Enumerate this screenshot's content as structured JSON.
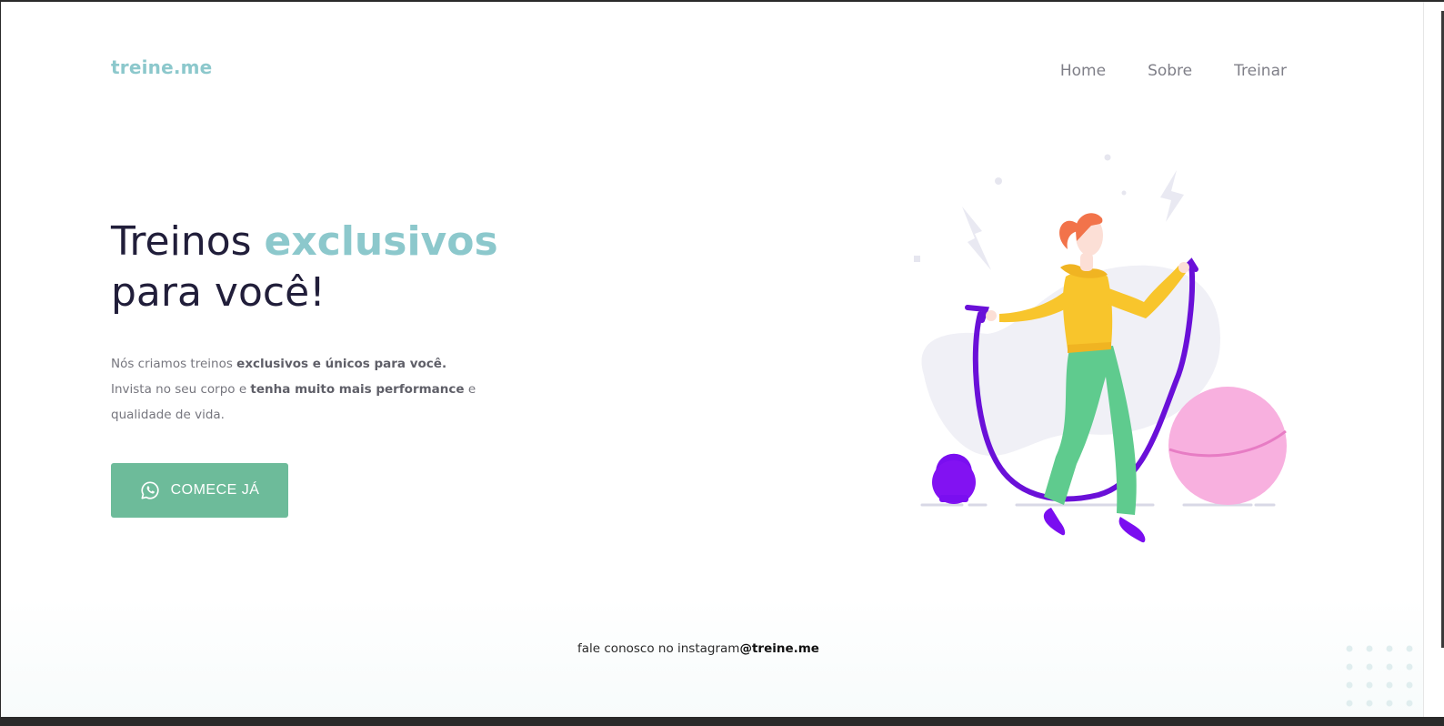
{
  "header": {
    "logo": "treine.me",
    "nav": [
      "Home",
      "Sobre",
      "Treinar"
    ]
  },
  "hero": {
    "title_part1": "Treinos ",
    "title_accent": "exclusivos",
    "title_part2": "para você!",
    "para_line1_a": "Nós criamos treinos ",
    "para_line1_b": "exclusivos e únicos para você.",
    "para_line2_a": "Invista no seu corpo e ",
    "para_line2_b": "tenha muito mais performance",
    "para_line2_c": " e",
    "para_line3": "qualidade de vida.",
    "cta_label": "COMECE JÁ",
    "cta_icon": "whatsapp-icon"
  },
  "illustration": {
    "subject": "woman-jumping-rope",
    "objects": [
      "kettlebell",
      "exercise-ball",
      "lightning-bolts"
    ]
  },
  "footer": {
    "text": "fale conosco no instagram",
    "handle": "@treine.me"
  },
  "colors": {
    "brand": "#8cc8cc",
    "button": "#6dbb9a",
    "title": "#211e3a",
    "text": "#76767e"
  }
}
